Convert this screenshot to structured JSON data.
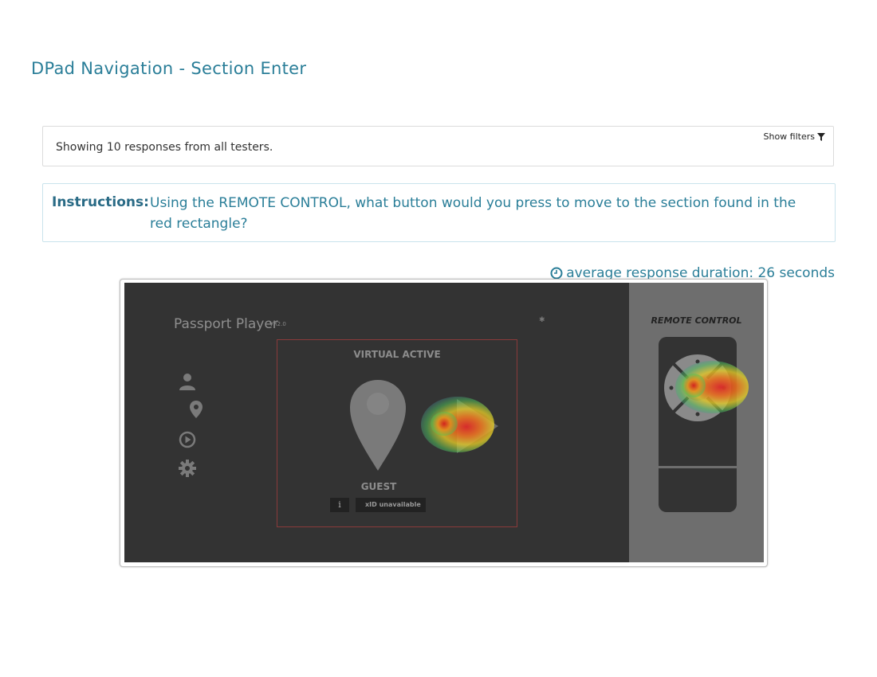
{
  "page": {
    "title": "DPad Navigation - Section Enter"
  },
  "summary": {
    "text": "Showing 10 responses from all testers.",
    "filters_label": "Show filters"
  },
  "instructions": {
    "label": "Instructions:",
    "text": "Using the REMOTE CONTROL, what button would you press to move to the section found in the red rectangle?"
  },
  "stats": {
    "avg_duration": "average response duration: 26 seconds"
  },
  "screenshot": {
    "app_title": "Passport Player",
    "app_version": "VR2.0",
    "section_label": "VIRTUAL ACTIVE",
    "profile_name": "GUEST",
    "info_label": "i",
    "xid_text": "xID unavailable",
    "remote_title": "REMOTE CONTROL",
    "side_icons": [
      "person-icon",
      "location-pin-icon",
      "play-circle-icon",
      "gear-icon"
    ]
  },
  "colors": {
    "accent": "#2a7e98",
    "screen_bg": "#333333",
    "remote_pane_bg": "#6e6e6e",
    "selection_rect": "#8a3a3a"
  }
}
